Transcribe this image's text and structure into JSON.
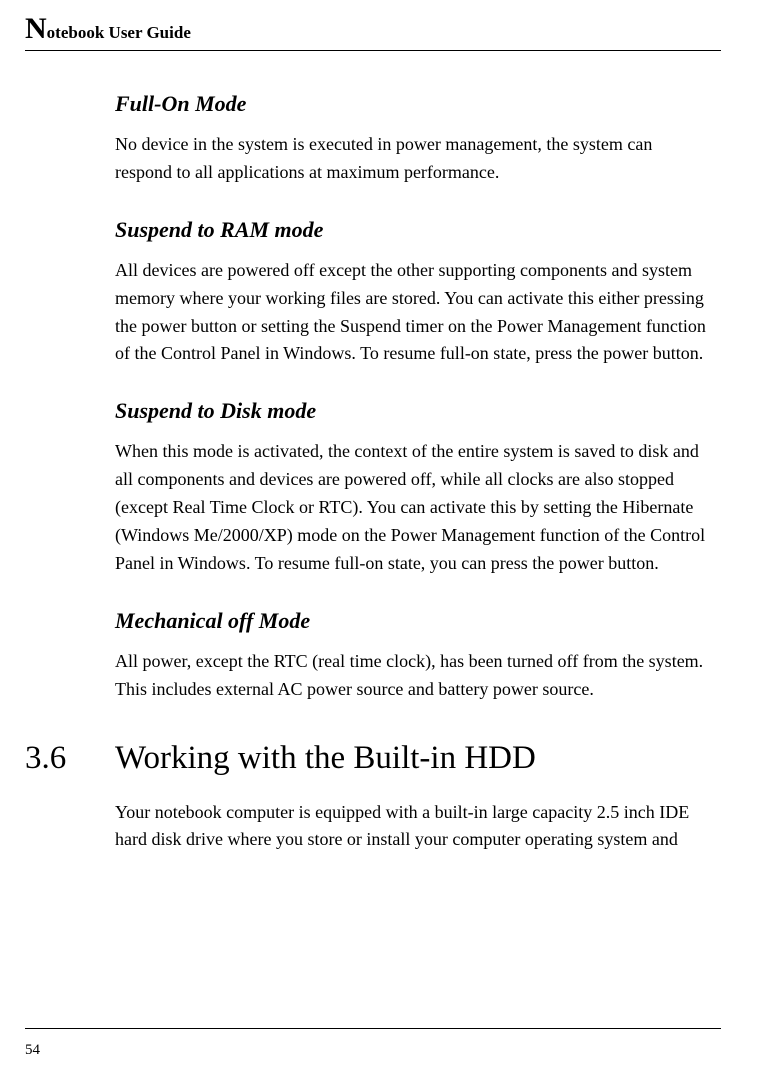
{
  "header": {
    "title_rest": "otebook User Guide"
  },
  "sections": {
    "full_on": {
      "heading": "Full-On Mode",
      "body": "No device in the system is executed in power management, the system can respond to all applications at maximum performance."
    },
    "suspend_ram": {
      "heading": "Suspend to RAM mode",
      "body": "All devices are powered off except the other supporting components and system memory where your working files are stored. You can activate this either pressing the power button or setting the Suspend timer on the Power Management function of the Control Panel in Windows. To resume full-on state, press the power button."
    },
    "suspend_disk": {
      "heading": "Suspend to Disk mode",
      "body": "When this mode is activated, the context of the entire system is saved to disk and all components and devices are powered off, while all clocks are also stopped (except Real Time Clock or RTC). You can activate this by setting the Hibernate (Windows Me/2000/XP) mode on the Power Management function of the Control Panel in Windows. To resume full-on state, you can press the power button."
    },
    "mechanical_off": {
      "heading": "Mechanical off Mode",
      "body": "All power, except the RTC (real time clock), has been turned off from the system. This includes external AC power source and battery power source."
    }
  },
  "chapter": {
    "number": "3.6",
    "title": "Working with the Built-in HDD",
    "body": "Your notebook computer is equipped with a built-in large capacity 2.5 inch IDE hard disk drive where you store or install your computer operating system and"
  },
  "page_number": "54"
}
